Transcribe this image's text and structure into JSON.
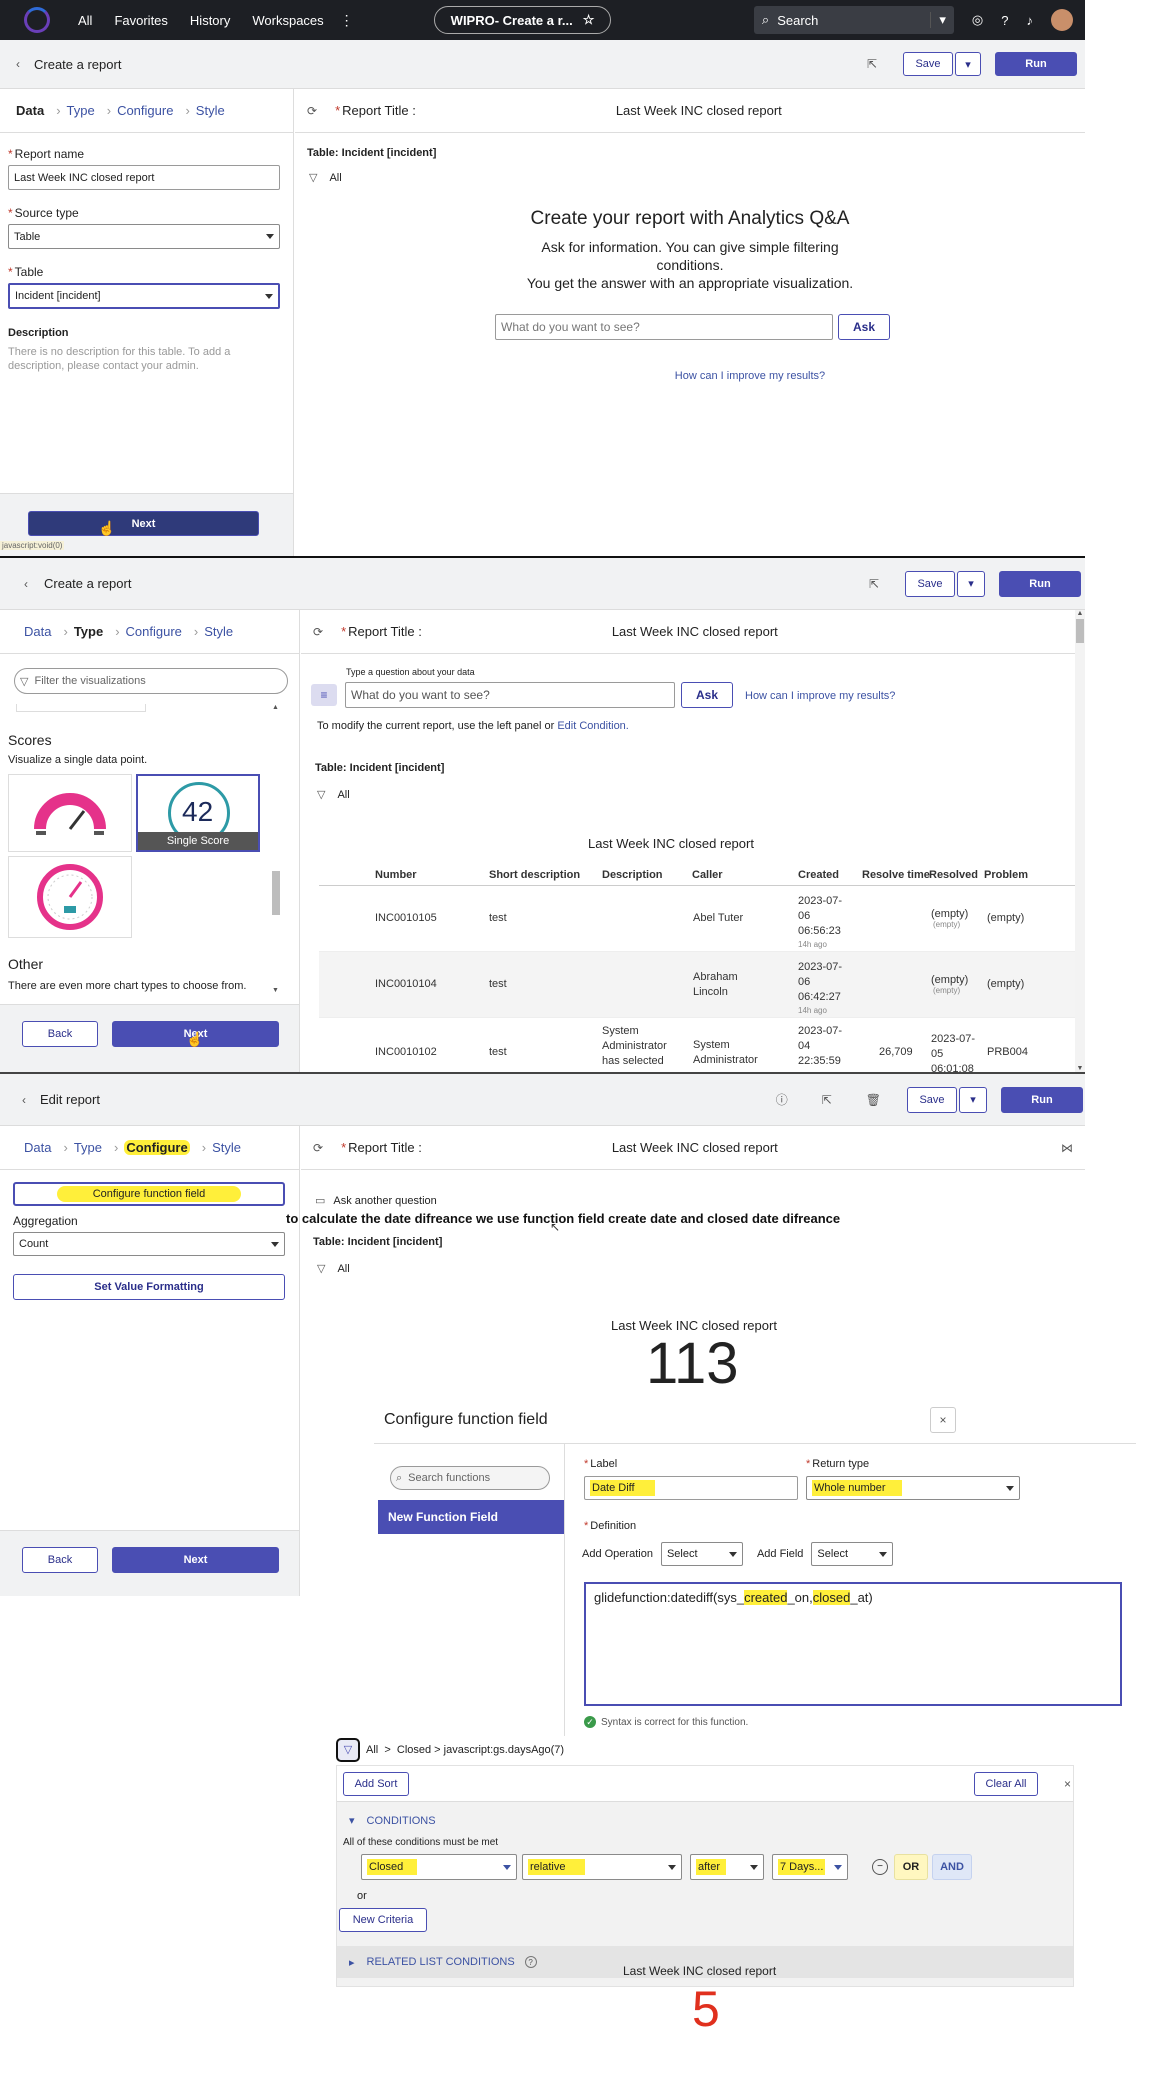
{
  "topnav": {
    "all": "All",
    "favorites": "Favorites",
    "history": "History",
    "workspaces": "Workspaces",
    "more": "⋮",
    "pill": "WIPRO- Create a r...",
    "search": "Search"
  },
  "p1": {
    "back_title": "Create a report",
    "save": "Save",
    "run": "Run",
    "tabs": [
      "Data",
      "Type",
      "Configure",
      "Style"
    ],
    "report_name_label": "Report name",
    "report_name_value": "Last Week INC closed report",
    "source_type_label": "Source type",
    "source_type_value": "Table",
    "table_label": "Table",
    "table_value": "Incident [incident]",
    "desc_label": "Description",
    "desc_text": "There is no description for this table. To add a description, please contact your admin.",
    "next": "Next",
    "status": "javascript:void(0)",
    "title_label": "Report Title :",
    "title_value": "Last Week INC closed report",
    "table_caption": "Table: Incident [incident]",
    "filter": "All",
    "qa_heading": "Create your report with Analytics Q&A",
    "qa_line1": "Ask for information. You can give simple filtering conditions.",
    "qa_line2": "You get the answer with an appropriate visualization.",
    "qa_placeholder": "What do you want to see?",
    "ask": "Ask",
    "improve": "How can I improve my results?"
  },
  "p2": {
    "back_title": "Create a report",
    "save": "Save",
    "run": "Run",
    "tabs": [
      "Data",
      "Type",
      "Configure",
      "Style"
    ],
    "filter_placeholder": "Filter the visualizations",
    "scores_heading": "Scores",
    "scores_desc": "Visualize a single data point.",
    "single_score_num": "42",
    "single_score_label": "Single Score",
    "other_heading": "Other",
    "other_desc": "There are even more chart types to choose from.",
    "back": "Back",
    "next": "Next",
    "title_label": "Report Title :",
    "title_value": "Last Week INC closed report",
    "question_label": "Type a question about your data",
    "qa_placeholder": "What do you want to see?",
    "ask": "Ask",
    "improve": "How can I improve my results?",
    "modify_text": "To modify the current report, use the left panel or",
    "edit_condition": "Edit Condition.",
    "table_caption": "Table: Incident [incident]",
    "filter": "All",
    "list_title": "Last Week INC closed report",
    "columns": [
      "Number",
      "Short description",
      "Description",
      "Caller",
      "Created",
      "Resolve time",
      "Resolved",
      "Problem"
    ],
    "rows": [
      {
        "number": "INC0010105",
        "short": "test",
        "desc": "",
        "caller": "Abel Tuter",
        "created": "2023-07-06 06:56:23",
        "ago": "14h ago",
        "resolve_time": "",
        "resolved": "(empty)",
        "resolved_sub": "(empty)",
        "problem": "(empty)"
      },
      {
        "number": "INC0010104",
        "short": "test",
        "desc": "",
        "caller": "Abraham Lincoln",
        "created": "2023-07-06 06:42:27",
        "ago": "14h ago",
        "resolved": "(empty)",
        "resolved_sub": "(empty)",
        "resolve_time": "",
        "problem": "(empty)"
      },
      {
        "number": "INC0010102",
        "short": "test",
        "desc": "System Administrator has selected",
        "caller": "System Administrator",
        "created": "2023-07-04 22:35:59",
        "ago": "",
        "resolve_time": "26,709",
        "resolved": "2023-07-05 06:01:08",
        "resolved_sub": "",
        "problem": "PRB004"
      }
    ]
  },
  "p3": {
    "back_title": "Edit report",
    "save": "Save",
    "run": "Run",
    "tabs": [
      "Data",
      "Type",
      "Configure",
      "Style"
    ],
    "config_fn_btn": "Configure function field",
    "aggregation_label": "Aggregation",
    "aggregation_value": "Count",
    "set_value_fmt": "Set Value Formatting",
    "back": "Back",
    "next": "Next",
    "title_label": "Report Title :",
    "title_value": "Last Week INC closed report",
    "ask_another": "Ask another question",
    "annotation": "to calculate the date difreance we use function field create date and closed date difreance",
    "table_caption": "Table: Incident [incident]",
    "filter": "All",
    "score_title": "Last Week INC closed report",
    "score_value": "113"
  },
  "modal": {
    "title": "Configure function field",
    "search_placeholder": "Search functions",
    "new_fn": "New Function Field",
    "label_label": "Label",
    "label_value": "Date Diff",
    "return_label": "Return type",
    "return_value": "Whole number",
    "definition_label": "Definition",
    "add_operation": "Add Operation",
    "add_field": "Add Field",
    "select1": "Select",
    "select2": "Select",
    "code_prefix": "glidefunction:datediff(sys_",
    "code_created": "created",
    "code_mid": "_on,",
    "code_closed": "closed",
    "code_suffix": "_at)",
    "syntax_ok": "Syntax is correct for this function."
  },
  "p4": {
    "breadcrumb": "All  >  Closed > javascript:gs.daysAgo(7)",
    "add_sort": "Add Sort",
    "clear_all": "Clear All",
    "conditions": "CONDITIONS",
    "all_met": "All of these conditions must be met",
    "field": "Closed",
    "operator": "relative",
    "when": "after",
    "value": "7 Days...",
    "or_btn": "OR",
    "and_btn": "AND",
    "or_label": "or",
    "new_criteria": "New Criteria",
    "related": "RELATED LIST CONDITIONS",
    "score_title": "Last Week INC closed report",
    "score_value": "5"
  },
  "colors": {
    "accent": "#4a4eb3",
    "highlight": "#ffef3a",
    "score_red": "#e0301e",
    "link": "#3c52a3"
  }
}
